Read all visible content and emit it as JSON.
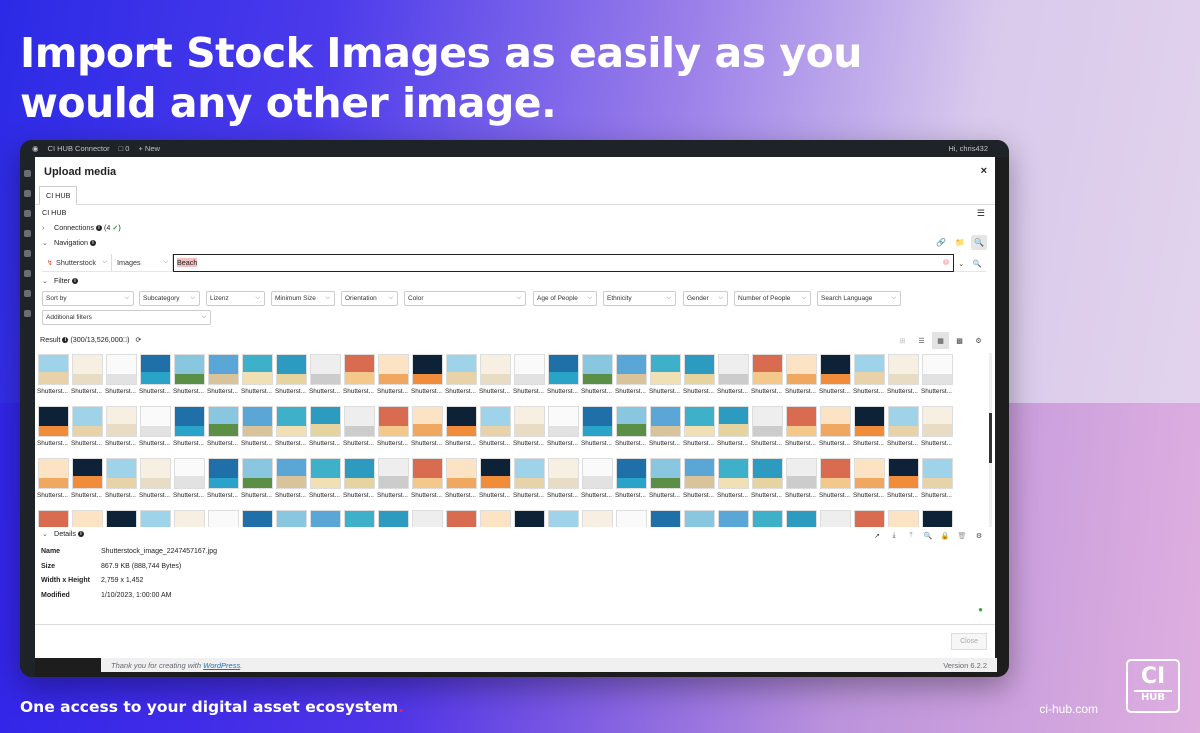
{
  "hero": {
    "headline_line1": "Import Stock Images as easily as you",
    "headline_line2": "would any other image.",
    "footer": "One access to your digital asset ecosystem",
    "footer_dot": ".",
    "site": "ci-hub.com",
    "logo_top": "CI",
    "logo_bottom": "HUB"
  },
  "wp": {
    "connector": "CI HUB Connector",
    "comments": "0",
    "new": "+ New",
    "greeting": "Hi, chris432",
    "thanks": "Thank you for creating with",
    "wordpress": "WordPress",
    "thanks_end": ".",
    "version": "Version 6.2.2"
  },
  "modal": {
    "title": "Upload media",
    "close": "×",
    "tab": "CI HUB",
    "section": "CI HUB",
    "connections": "Connections",
    "connections_count": "(4",
    "navigation": "Navigation",
    "source": "Shutterstock",
    "type": "Images",
    "search": "Beach",
    "filter": "Filter",
    "filters": [
      "Sort by",
      "Subcategory",
      "Lizenz",
      "Minimum Size",
      "Orientation",
      "Color",
      "Age of People",
      "Ethnicity",
      "Gender",
      "Number of People",
      "Search Language"
    ],
    "additional_filters": "Additional filters",
    "result_label": "Result",
    "result_count": "(300/13,526,000",
    "item_caption": "Shutterst...",
    "details": "Details",
    "detail_rows": [
      {
        "label": "Name",
        "value": "Shutterstock_image_2247457167.jpg"
      },
      {
        "label": "Size",
        "value": "867.9 KB (888,744 Bytes)"
      },
      {
        "label": "Width x Height",
        "value": "2,759 x 1,452"
      },
      {
        "label": "Modified",
        "value": "1/10/2023, 1:00:00 AM"
      }
    ],
    "close_button": "Close"
  },
  "colors": {
    "accent": "#2c2ae6",
    "ok": "#2e9b38",
    "search_highlight": "#f6c0c0"
  }
}
